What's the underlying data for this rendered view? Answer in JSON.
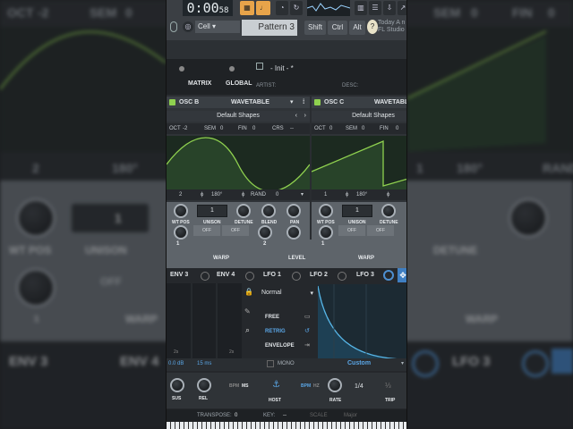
{
  "background": {
    "oct_label": "OCT",
    "oct_value": "-2",
    "sem_label": "SEM",
    "sem_value": "0",
    "right_sem_label": "SEM",
    "right_sem_value": "0",
    "fin_label": "FIN",
    "fin_value": "0",
    "phase_value": "2",
    "phase_deg": "180°",
    "right_phase_value": "1",
    "right_phase_deg": "180°",
    "rand_label": "RAND",
    "unison_value": "1",
    "wt_pos_label": "WT POS",
    "unison_label": "UNISON",
    "detune_label": "DETUNE",
    "warp_label": "WARP",
    "off_label": "OFF",
    "env3_label": "ENV 3",
    "env4_label": "ENV 4",
    "lfo3_label": "LFO 3",
    "warp_min": "1"
  },
  "toolbar": {
    "time": "0:00",
    "time_sub": "58",
    "cell_select": "Cell",
    "pattern": "Pattern 3",
    "shift": "Shift",
    "ctrl": "Ctrl",
    "alt": "Alt",
    "news_line1": "Today",
    "news_line2": "FL Studio",
    "news_tail": "A n"
  },
  "plugin": {
    "matrix_tab": "MATRIX",
    "global_tab": "GLOBAL",
    "preset_name": "- Init - *",
    "artist_label": "ARTIST:",
    "desc_label": "DESC:"
  },
  "osc_b": {
    "title": "OSC B",
    "type": "WAVETABLE",
    "shape": "Default Shapes",
    "oct_label": "OCT",
    "oct": "-2",
    "sem_label": "SEM",
    "sem": "0",
    "fin_label": "FIN",
    "fin": "0",
    "crs_label": "CRS",
    "crs": "--",
    "phase": "2",
    "phase_deg": "180°",
    "rand_label": "RAND",
    "rand": "0",
    "unison": "1",
    "off1": "OFF",
    "off2": "OFF",
    "wt_pos": "WT POS",
    "unison_lbl": "UNISON",
    "detune": "DETUNE",
    "blend": "BLEND",
    "pan": "PAN",
    "level": "LEVEL",
    "warp": "WARP",
    "warp_min": "1",
    "warp_max": "2"
  },
  "osc_c": {
    "title": "OSC C",
    "type": "WAVETABLE",
    "shape": "Default Shapes",
    "oct_label": "OCT",
    "oct": "0",
    "sem_label": "SEM",
    "sem": "0",
    "fin_label": "FIN",
    "fin": "0",
    "phase": "1",
    "phase_deg": "180°",
    "unison": "1",
    "off1": "OFF",
    "off2": "OFF",
    "wt_pos": "WT POS",
    "unison_lbl": "UNISON",
    "detune": "DETUNE",
    "warp": "WARP",
    "warp_min": "1"
  },
  "mod": {
    "env3": "ENV 3",
    "env4": "ENV 4",
    "lfo1": "LFO 1",
    "lfo2": "LFO 2",
    "lfo3": "LFO 3",
    "mode_select": "Normal",
    "free": "FREE",
    "retrig": "RETRIG",
    "envelope": "ENVELOPE",
    "env_sustain": "0.0 dB",
    "env_release": "15 ms",
    "mono": "MONO",
    "custom": "Custom",
    "env_val_1": "2s",
    "env_val_2": "2s",
    "sus": "SUS",
    "rel": "REL",
    "bpm": "BPM",
    "ms": "MS",
    "bpm2": "BPM",
    "hz": "HZ",
    "host": "HOST",
    "rate": "RATE",
    "trip": "TRIP",
    "rate_value": "1/4"
  },
  "footer": {
    "transpose_label": "TRANSPOSE:",
    "transpose": "0",
    "key_label": "KEY:",
    "key": "--",
    "scale_label": "SCALE",
    "scale": "Major"
  },
  "colors": {
    "accent_green": "#8fd14f",
    "accent_blue": "#4d8fd1",
    "lfo_curve": "#57b6e8",
    "toolbar_orange": "#e8a44a"
  }
}
